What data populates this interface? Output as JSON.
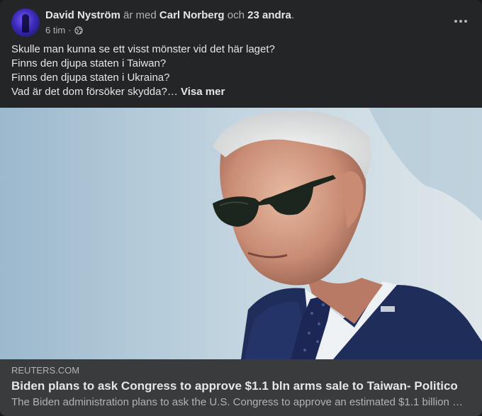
{
  "post": {
    "author": "David Nyström",
    "with_text": "är med",
    "tagged": "Carl Norberg",
    "and_text": "och",
    "others": "23 andra",
    "period": ".",
    "time": "6 tim",
    "separator": "·",
    "privacy_icon": "globe-icon",
    "menu_icon": "more-icon",
    "text_lines": [
      "Skulle man kunna se ett visst mönster vid det här laget?",
      "Finns den djupa staten i Taiwan?",
      "Finns den djupa staten i Ukraina?",
      "Vad är det dom försöker skydda?…"
    ],
    "see_more": "Visa mer"
  },
  "link": {
    "domain": "REUTERS.COM",
    "title": "Biden plans to ask Congress to approve $1.1 bln arms sale to Taiwan- Politico",
    "description": "The Biden administration plans to ask the U.S. Congress to approve an estimated $1.1 billion …"
  },
  "colors": {
    "card": "#242526",
    "link_bar": "#3a3b3c",
    "text_primary": "#e4e6eb",
    "text_secondary": "#b0b3b8"
  }
}
